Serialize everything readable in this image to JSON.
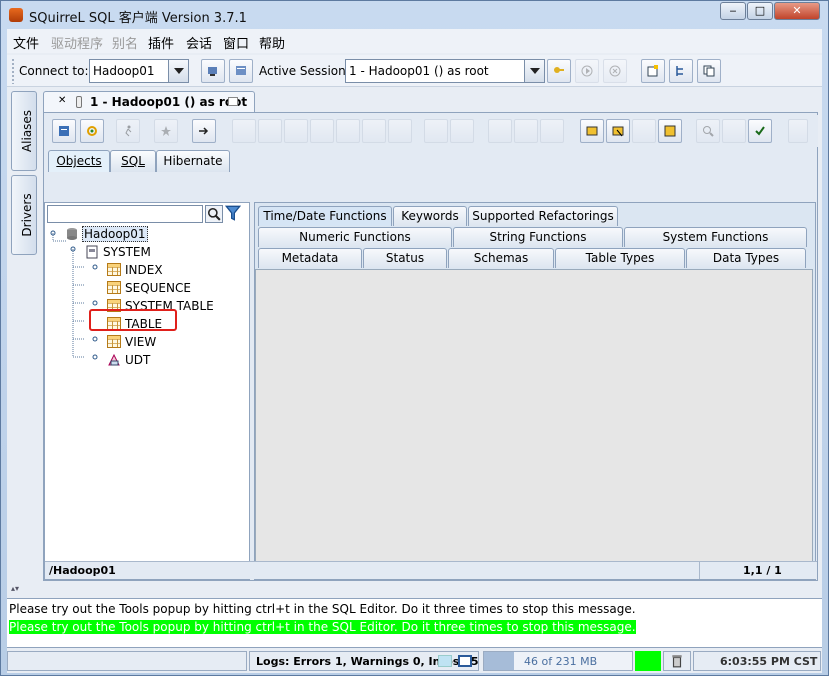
{
  "window": {
    "title": "SQuirreL SQL 客户端 Version 3.7.1",
    "btn_min": "‒",
    "btn_max": "□",
    "btn_close": "✕"
  },
  "menu": [
    "文件",
    "驱动程序",
    "别名",
    "插件",
    "会话",
    "窗口",
    "帮助"
  ],
  "toolbar": {
    "connect_label": "Connect to:",
    "connect_value": "Hadoop01",
    "active_session_label": "Active Session:",
    "active_session_value": "1 - Hadoop01 () as root"
  },
  "sidebar": {
    "aliases": "Aliases",
    "drivers": "Drivers"
  },
  "session_tab": {
    "close": "✕",
    "title": "1 - Hadoop01 () as root"
  },
  "inner_tabs": [
    "Objects",
    "SQL",
    "Hibernate"
  ],
  "tree": {
    "root": "Hadoop01",
    "schema": "SYSTEM",
    "types": [
      "INDEX",
      "SEQUENCE",
      "SYSTEM TABLE",
      "TABLE",
      "VIEW",
      "UDT"
    ]
  },
  "meta_tabs": {
    "row1": [
      "Time/Date Functions",
      "Keywords",
      "Supported Refactorings"
    ],
    "row2": [
      "Numeric Functions",
      "String Functions",
      "System Functions"
    ],
    "row3": [
      "Metadata",
      "Status",
      "Schemas",
      "Table Types",
      "Data Types"
    ]
  },
  "status": {
    "path": "/Hadoop01",
    "position": "1,1 / 1"
  },
  "messages": [
    "Please try out the Tools popup by hitting ctrl+t in the SQL Editor. Do it three times to stop this message.",
    "Please try out the Tools popup by hitting ctrl+t in the SQL Editor. Do it three times to stop this message."
  ],
  "bottom": {
    "logs": "Logs: Errors 1, Warnings 0, Infos 45",
    "memory": "46 of 231 MB",
    "memory_fraction": 0.2,
    "time": "6:03:55 PM CST"
  },
  "colors": {
    "highlight_red": "#e0201b",
    "message_green": "#00ff00",
    "memory_fill": "#a6bcd8"
  }
}
